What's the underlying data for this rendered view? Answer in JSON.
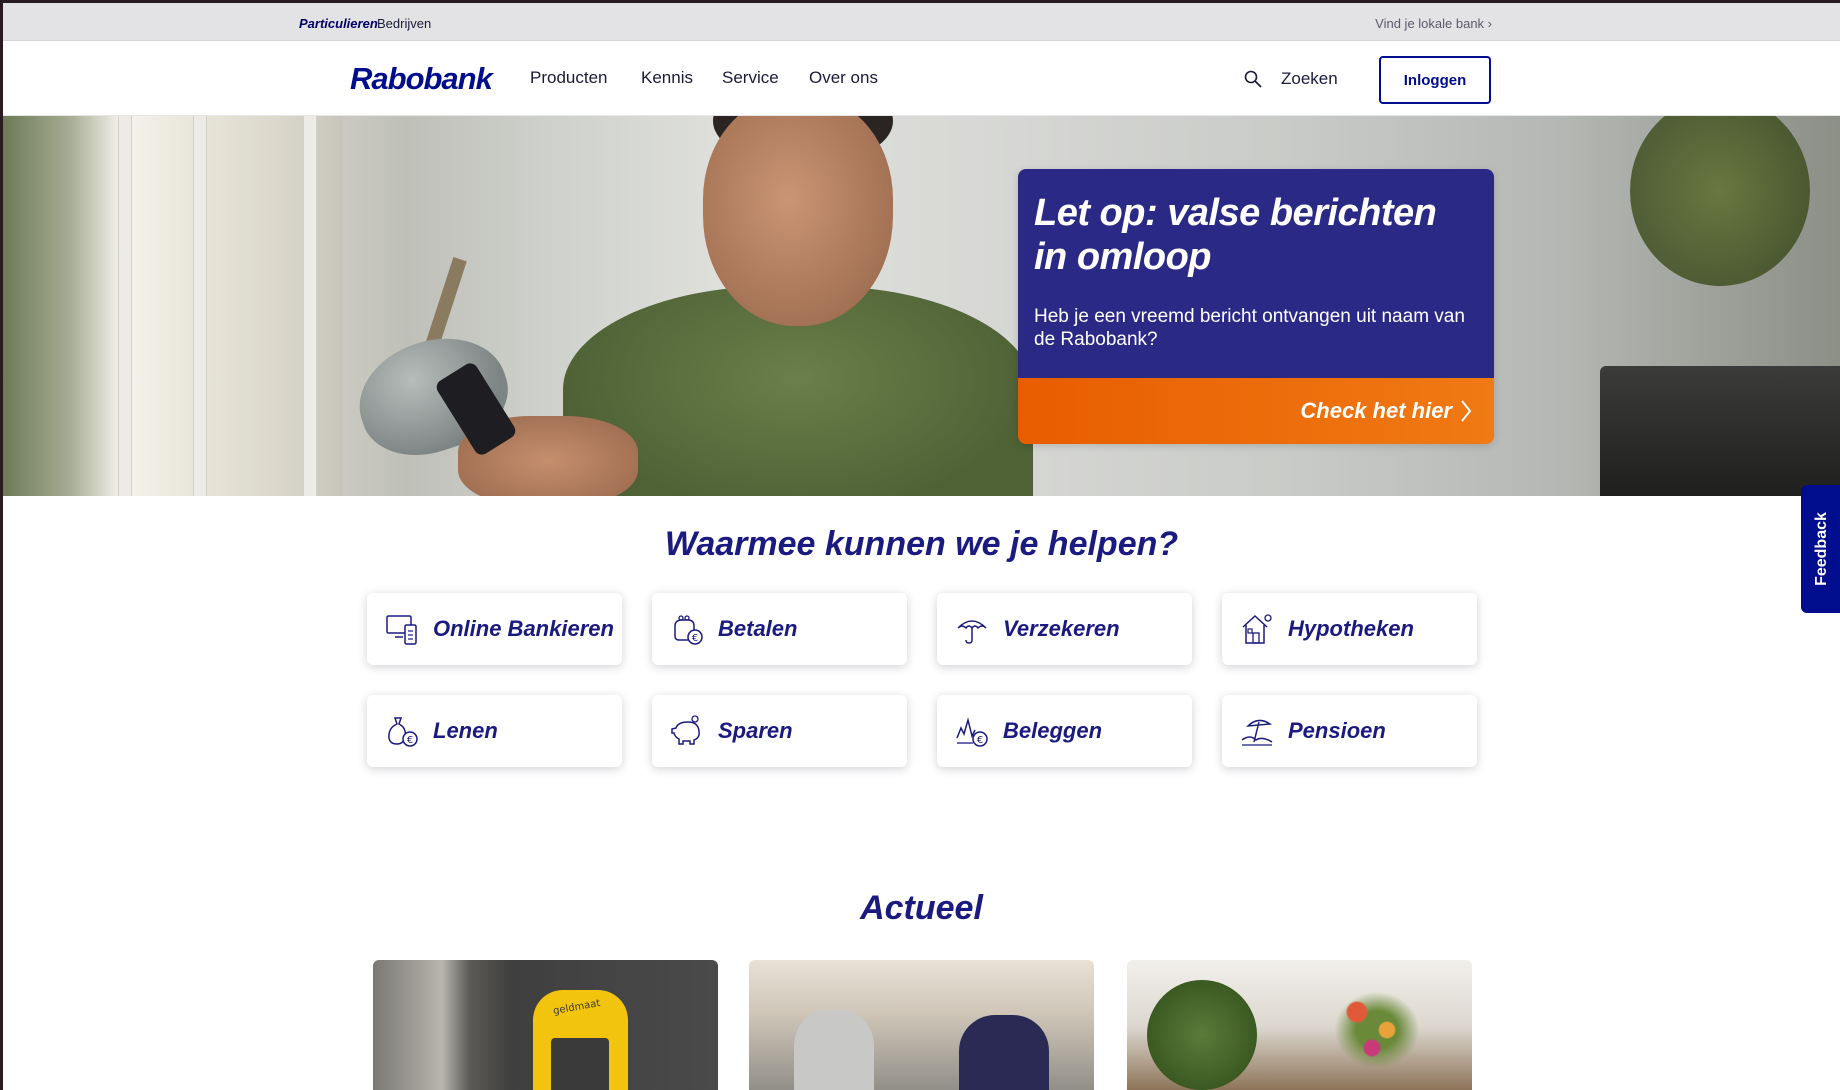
{
  "topbar": {
    "segments": [
      "Particulieren",
      "Bedrijven"
    ],
    "active_segment": "Particulieren",
    "local_bank_link": "Vind je lokale bank ›"
  },
  "header": {
    "logo": "Rabobank",
    "nav": [
      "Producten",
      "Kennis",
      "Service",
      "Over ons"
    ],
    "search_label": "Zoeken",
    "login_label": "Inloggen"
  },
  "hero": {
    "alert_title": "Let op: valse berichten in omloop",
    "alert_text": "Heb je een vreemd bericht ontvangen uit naam van de Rabobank?",
    "alert_cta": "Check het hier",
    "colors": {
      "card": "#2a2a86",
      "cta": "#ee6c0e"
    }
  },
  "feedback": {
    "label": "Feedback"
  },
  "help": {
    "title": "Waarmee kunnen we je helpen?",
    "tiles": [
      {
        "label": "Online Bankieren",
        "icon": "devices-icon"
      },
      {
        "label": "Betalen",
        "icon": "purse-euro-icon"
      },
      {
        "label": "Verzekeren",
        "icon": "umbrella-icon"
      },
      {
        "label": "Hypotheken",
        "icon": "house-icon"
      },
      {
        "label": "Lenen",
        "icon": "moneybag-euro-icon"
      },
      {
        "label": "Sparen",
        "icon": "piggybank-icon"
      },
      {
        "label": "Beleggen",
        "icon": "graph-euro-icon"
      },
      {
        "label": "Pensioen",
        "icon": "beach-umbrella-icon"
      }
    ]
  },
  "news": {
    "title": "Actueel",
    "cards": [
      {
        "image": "geldmaat-atm-photo",
        "atm_text": "geldmaat"
      },
      {
        "image": "kitchen-meeting-photo"
      },
      {
        "image": "living-room-photo"
      }
    ]
  },
  "colors": {
    "brand": "#000d8c",
    "heading": "#1a1a80",
    "orange": "#ee6c0e"
  }
}
